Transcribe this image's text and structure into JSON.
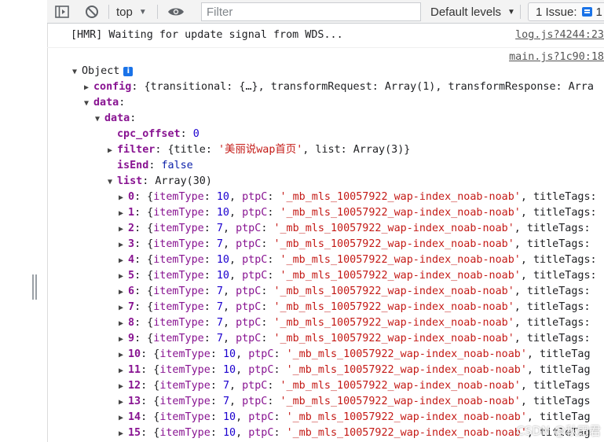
{
  "toolbar": {
    "context": "top",
    "filter_placeholder": "Filter",
    "levels": "Default levels",
    "issues_label": "1 Issue:",
    "issues_count": "1"
  },
  "console": {
    "hmr": {
      "text": "[HMR] Waiting for update signal from WDS...",
      "source": "log.js?4244:23"
    },
    "object_source": "main.js?1c90:18",
    "object_label": "Object",
    "config": {
      "key": "config",
      "value": "{transitional: {…}, transformRequest: Array(1), transformResponse: Arra"
    },
    "data_outer": "data",
    "data_inner": "data",
    "cpc_offset": {
      "key": "cpc_offset",
      "value": "0"
    },
    "filter": {
      "key": "filter",
      "pre": "{title: ",
      "title": "'美丽说wap首页'",
      "post": ", list: Array(3)}"
    },
    "isEnd": {
      "key": "isEnd",
      "value": "false"
    },
    "list": {
      "key": "list",
      "value": "Array(30)"
    },
    "items": [
      {
        "idx": "0",
        "itemType": "10",
        "ptpC": "'_mb_mls_10057922_wap-index_noab-noab'",
        "tail": "titleTags:"
      },
      {
        "idx": "1",
        "itemType": "10",
        "ptpC": "'_mb_mls_10057922_wap-index_noab-noab'",
        "tail": "titleTags:"
      },
      {
        "idx": "2",
        "itemType": "7",
        "ptpC": "'_mb_mls_10057922_wap-index_noab-noab'",
        "tail": "titleTags:"
      },
      {
        "idx": "3",
        "itemType": "7",
        "ptpC": "'_mb_mls_10057922_wap-index_noab-noab'",
        "tail": "titleTags:"
      },
      {
        "idx": "4",
        "itemType": "10",
        "ptpC": "'_mb_mls_10057922_wap-index_noab-noab'",
        "tail": "titleTags:"
      },
      {
        "idx": "5",
        "itemType": "10",
        "ptpC": "'_mb_mls_10057922_wap-index_noab-noab'",
        "tail": "titleTags:"
      },
      {
        "idx": "6",
        "itemType": "7",
        "ptpC": "'_mb_mls_10057922_wap-index_noab-noab'",
        "tail": "titleTags:"
      },
      {
        "idx": "7",
        "itemType": "7",
        "ptpC": "'_mb_mls_10057922_wap-index_noab-noab'",
        "tail": "titleTags:"
      },
      {
        "idx": "8",
        "itemType": "7",
        "ptpC": "'_mb_mls_10057922_wap-index_noab-noab'",
        "tail": "titleTags:"
      },
      {
        "idx": "9",
        "itemType": "7",
        "ptpC": "'_mb_mls_10057922_wap-index_noab-noab'",
        "tail": "titleTags:"
      },
      {
        "idx": "10",
        "itemType": "10",
        "ptpC": "'_mb_mls_10057922_wap-index_noab-noab'",
        "tail": "titleTag"
      },
      {
        "idx": "11",
        "itemType": "10",
        "ptpC": "'_mb_mls_10057922_wap-index_noab-noab'",
        "tail": "titleTag"
      },
      {
        "idx": "12",
        "itemType": "7",
        "ptpC": "'_mb_mls_10057922_wap-index_noab-noab'",
        "tail": "titleTags"
      },
      {
        "idx": "13",
        "itemType": "7",
        "ptpC": "'_mb_mls_10057922_wap-index_noab-noab'",
        "tail": "titleTags"
      },
      {
        "idx": "14",
        "itemType": "10",
        "ptpC": "'_mb_mls_10057922_wap-index_noab-noab'",
        "tail": "titleTag"
      },
      {
        "idx": "15",
        "itemType": "10",
        "ptpC": "'_mb_mls_10057922_wap-index_noab-noab'",
        "tail": "titleTag"
      }
    ]
  },
  "watermark": "CSDN @秋田君"
}
